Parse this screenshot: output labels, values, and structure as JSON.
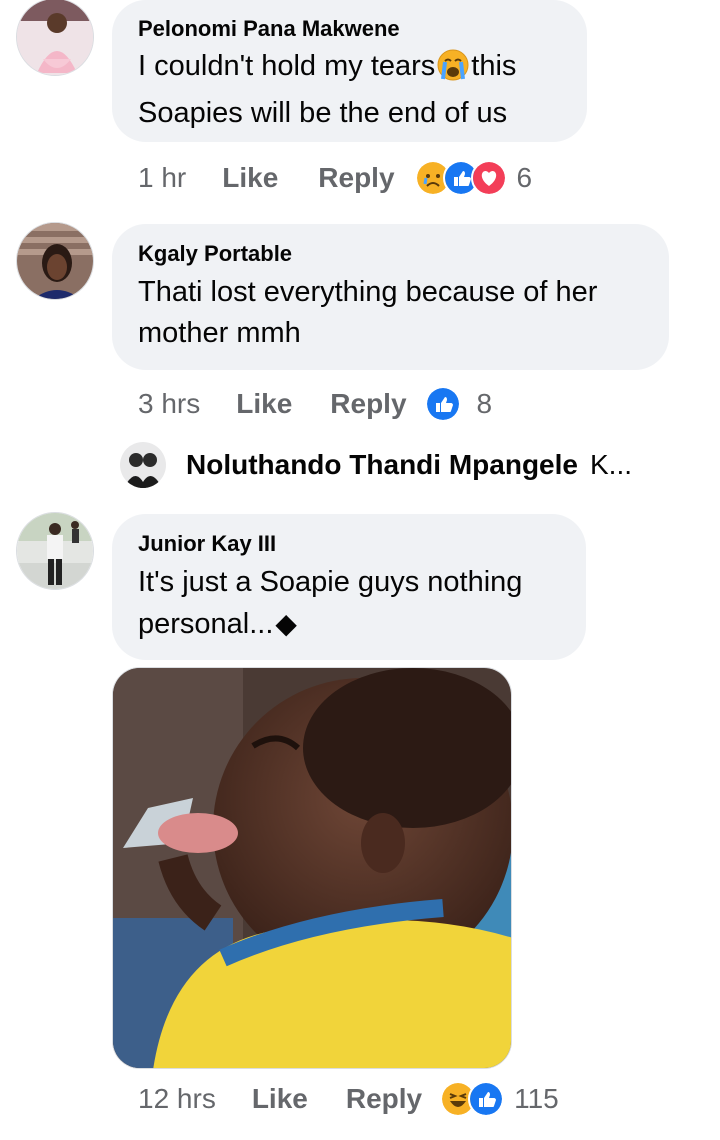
{
  "comments": [
    {
      "author": "Pelonomi Pana Makwene",
      "text_line1": "I couldn't hold my tears",
      "text_line1_after": "this",
      "text_line2": "Soapies will be the end of us",
      "time": "1 hr",
      "like": "Like",
      "reply": "Reply",
      "reactions": [
        "sad-reaction-icon",
        "like-reaction-icon",
        "love-reaction-icon"
      ],
      "reaction_count": "6"
    },
    {
      "author": "Kgaly Portable",
      "text_line1": "Thati lost everything because of her",
      "text_line2": "mother mmh",
      "time": "3 hrs",
      "like": "Like",
      "reply": "Reply",
      "reactions": [
        "like-reaction-icon"
      ],
      "reaction_count": "8"
    },
    {
      "author": "Junior Kay III",
      "text_line1": "It's just a Soapie guys nothing",
      "text_line2": "personal...",
      "text_line2_glyph": "◆",
      "time": "12 hrs",
      "like": "Like",
      "reply": "Reply",
      "reactions": [
        "haha-reaction-icon",
        "like-reaction-icon"
      ],
      "reaction_count": "115"
    }
  ],
  "reply_preview": {
    "author": "Noluthando Thandi Mpangele",
    "snippet": "K..."
  },
  "colors": {
    "bubble": "#f0f2f5",
    "meta_text": "#65676b",
    "like_blue": "#1877f2",
    "love_red": "#f33e58",
    "emoji_yellow": "#f7b125"
  }
}
